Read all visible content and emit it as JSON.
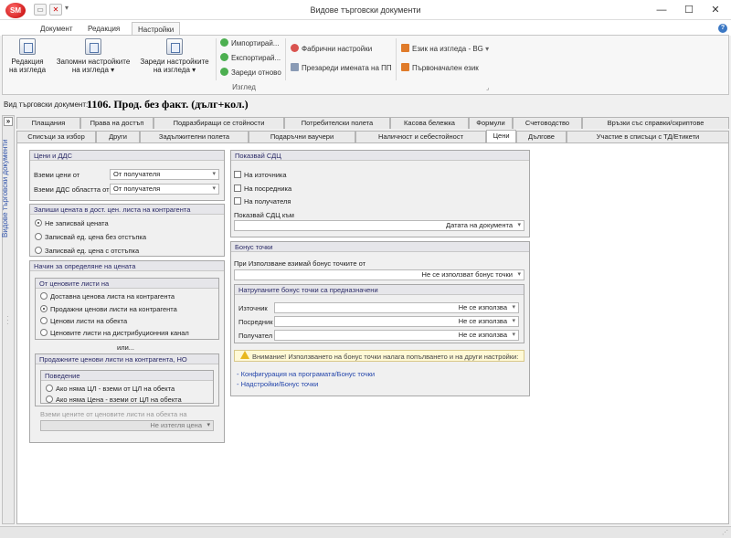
{
  "window": {
    "title": "Видове търговски документи",
    "logo": "SM"
  },
  "ribbon": {
    "tabs": [
      "Документ",
      "Редакция",
      "Настройки"
    ],
    "active_tab": "Настройки",
    "big_buttons": [
      "Редакция на изгледа",
      "Запомни настройките на изгледа ▾",
      "Зареди настройките на изгледа ▾"
    ],
    "small_buttons": [
      "Импортирай...",
      "Експортирай...",
      "Зареди отново",
      "Фабрични настройки",
      "Презареди имената на ПП",
      "Език на изгледа - BG",
      "Първоначален език"
    ],
    "group_name": "Изглед"
  },
  "doc": {
    "label": "Вид търговски документ:",
    "value": "1106. Прод. без факт. (дълг+кол.)"
  },
  "sidebar": {
    "label": "Видове търговски документи"
  },
  "tabs_row1": [
    "Плащания",
    "Права на достъп",
    "Подразбиращи се стойности",
    "Потребителски полета",
    "Касова бележка",
    "Формули",
    "Счетоводство",
    "Връзки със справки/скриптове"
  ],
  "tabs_row2": [
    "Списъци за избор",
    "Други",
    "Задължителни полета",
    "Подаръчни ваучери",
    "Наличност и себестойност",
    "Цени",
    "Дългове",
    "Участие в списъци с ТД/Етикети"
  ],
  "active_tab2": "Цени",
  "prices": {
    "header": "Цени и ДДС",
    "take_prices_label": "Вземи цени от",
    "take_prices_value": "От получателя",
    "take_vat_label": "Вземи ДДС областта от",
    "take_vat_value": "От получателя"
  },
  "save_price": {
    "header": "Запиши цената в дост. цен. листа на контрагента",
    "options": [
      "Не записвай цената",
      "Записвай ед. цена без отстъпка",
      "Записвай ед. цена с отстъпка"
    ],
    "selected": 0
  },
  "method": {
    "header": "Начин за определяне на цената",
    "sub_header": "От ценовите листи на",
    "options": [
      "Доставна ценова листа на контрагента",
      "Продажни ценови листи на контрагента",
      "Ценови листи на обекта",
      "Ценовите листи на дистрибуционния канал"
    ],
    "selected": 1,
    "or_label": "или...",
    "nested_header": "Продажните ценови листи на контрагента, НО",
    "behaviour_header": "Поведение",
    "behaviour_options": [
      "Ако няма ЦЛ - вземи от ЦЛ на обекта",
      "Ако няма Цена - вземи от ЦЛ на обекта"
    ],
    "object_prices_label": "Вземи цените от ценовите листи на обекта на",
    "object_prices_value": "Не изтегля цена"
  },
  "sdc": {
    "header": "Показвай СДЦ",
    "checks": [
      "На източника",
      "На посредника",
      "На получателя"
    ],
    "to_label": "Показвай СДЦ към",
    "to_value": "Датата на документа"
  },
  "bonus": {
    "header": "Бонус точки",
    "use_label": "При Използване взимай бонус точките от",
    "use_value": "Не се използват бонус точки",
    "accum_header": "Натрупаните бонус точки са предназначени",
    "rows": [
      {
        "label": "Източник",
        "value": "Не се използва"
      },
      {
        "label": "Посредник",
        "value": "Не се използва"
      },
      {
        "label": "Получател",
        "value": "Не се използва"
      }
    ],
    "warning": "Внимание! Използването на бонус точки налага попълването и на други настройки:",
    "links": [
      "- Конфигурация на програмата/Бонус точки",
      "- Надстройки/Бонус точки"
    ]
  }
}
